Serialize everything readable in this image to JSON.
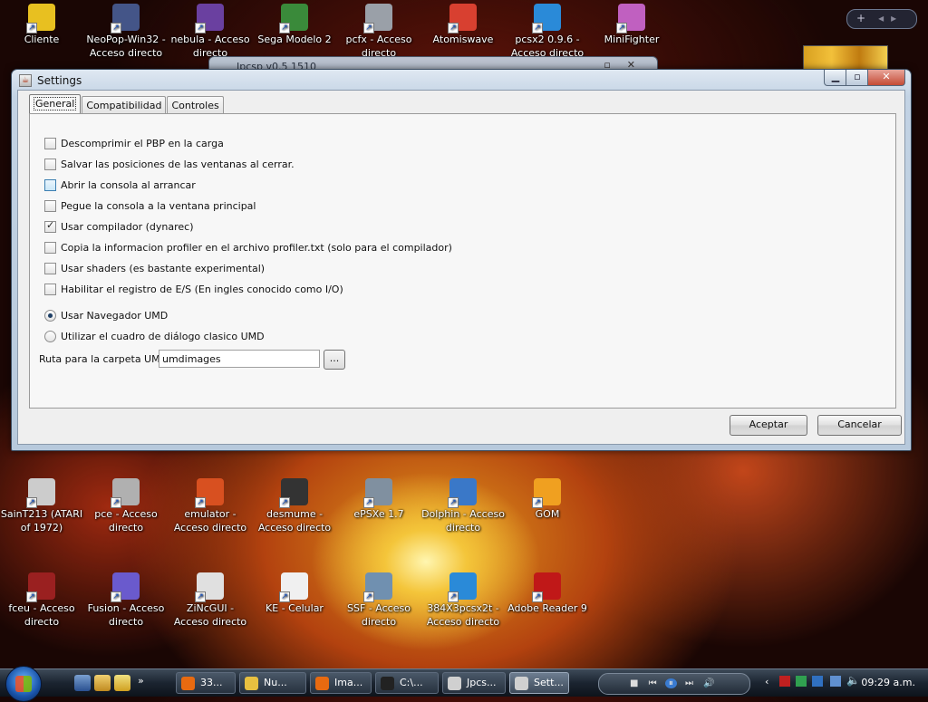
{
  "desktop": {
    "icons_top": [
      {
        "label": "Cliente",
        "color": "#e8c020"
      },
      {
        "label": "NeoPop-Win32 - Acceso directo",
        "color": "#445588"
      },
      {
        "label": "nebula - Acceso directo",
        "color": "#6a40a0"
      },
      {
        "label": "Sega Modelo 2",
        "color": "#3a8a3a"
      },
      {
        "label": "pcfx - Acceso directo",
        "color": "#9aa0a8"
      },
      {
        "label": "Atomiswave",
        "color": "#d84030"
      },
      {
        "label": "pcsx2 0.9.6 - Acceso directo",
        "color": "#2a8ad8"
      },
      {
        "label": "MiniFighter",
        "color": "#c060c0"
      }
    ],
    "icons_mid": [
      {
        "label": "SainT213 (ATARI of 1972)",
        "color": "#cccccc"
      },
      {
        "label": "pce - Acceso directo",
        "color": "#b0b0b0"
      },
      {
        "label": "emulator - Acceso directo",
        "color": "#d85020"
      },
      {
        "label": "desmume - Acceso directo",
        "color": "#333333"
      },
      {
        "label": "ePSXe 1.7",
        "color": "#8090a0"
      },
      {
        "label": "Dolphin - Acceso directo",
        "color": "#3a78c8"
      },
      {
        "label": "GOM",
        "color": "#f0a020"
      }
    ],
    "icons_bottom": [
      {
        "label": "fceu - Acceso directo",
        "color": "#9a2020"
      },
      {
        "label": "Fusion - Acceso directo",
        "color": "#6a5acd"
      },
      {
        "label": "ZiNcGUI - Acceso directo",
        "color": "#e0e0e0"
      },
      {
        "label": "KE - Celular",
        "color": "#f0f0f0"
      },
      {
        "label": "SSF - Acceso directo",
        "color": "#7090b0"
      },
      {
        "label": "384X3pcsx2t - Acceso directo",
        "color": "#2a8ad8"
      },
      {
        "label": "Adobe Reader 9",
        "color": "#c01818"
      }
    ]
  },
  "background_window": {
    "title": "Jpcsp v0.5 1510"
  },
  "window": {
    "title": "Settings",
    "tabs": [
      {
        "label": "General",
        "active": true
      },
      {
        "label": "Compatibilidad",
        "active": false
      },
      {
        "label": "Controles",
        "active": false
      }
    ],
    "checkboxes": [
      {
        "label": "Descomprimir el PBP en la carga",
        "checked": false
      },
      {
        "label": "Salvar las posiciones de las ventanas al cerrar.",
        "checked": false
      },
      {
        "label": "Abrir la consola al arrancar",
        "checked": false
      },
      {
        "label": "Pegue la consola a la ventana principal",
        "checked": false
      },
      {
        "label": "Usar compilador (dynarec)",
        "checked": true
      },
      {
        "label": "Copia la informacion profiler en el archivo profiler.txt (solo para el compilador)",
        "checked": false
      },
      {
        "label": "Usar shaders (es bastante experimental)",
        "checked": false
      },
      {
        "label": "Habilitar el registro de E/S (En ingles conocido como I/O)",
        "checked": false
      }
    ],
    "radios": [
      {
        "label": "Usar Navegador UMD",
        "checked": true
      },
      {
        "label": "Utilizar el cuadro de diálogo clasico UMD",
        "checked": false
      }
    ],
    "umd_path": {
      "label": "Ruta para la carpeta UMD",
      "value": "umdimages",
      "browse_label": "..."
    },
    "ok_label": "Aceptar",
    "cancel_label": "Cancelar"
  },
  "taskbar": {
    "buttons": [
      {
        "label": "33...",
        "color": "#e86a10",
        "active": false
      },
      {
        "label": "Nu...",
        "color": "#e8c040",
        "active": false
      },
      {
        "label": "Ima...",
        "color": "#e86a10",
        "active": false
      },
      {
        "label": "C:\\...",
        "color": "#222222",
        "active": false
      },
      {
        "label": "Jpcs...",
        "color": "#d0d0d0",
        "active": false
      },
      {
        "label": "Sett...",
        "color": "#d0d0d0",
        "active": true
      }
    ],
    "clock": "09:29 a.m."
  }
}
